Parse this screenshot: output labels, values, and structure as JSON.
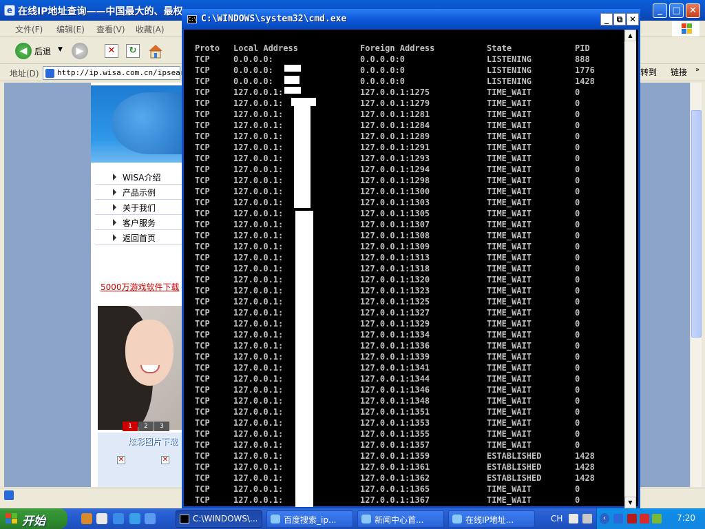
{
  "ie": {
    "title": "在线IP地址查询——中国最大的、最权",
    "menu": [
      "文件(F)",
      "编辑(E)",
      "查看(V)",
      "收藏(A)"
    ],
    "back_label": "后退",
    "address_label": "地址(D)",
    "url": "http://ip.wisa.com.cn/ipsearch",
    "go_label": "转到",
    "links_label": "链接"
  },
  "site": {
    "nav": [
      "WISA介绍",
      "产品示例",
      "关于我们",
      "客户服务",
      "返回首页"
    ],
    "ad_text": "5000万游戏软件下载",
    "pager": [
      "1",
      "2",
      "3"
    ],
    "download_title": "炫彩图片下载"
  },
  "cmd": {
    "title": "C:\\WINDOWS\\system32\\cmd.exe",
    "header": {
      "proto": "Proto",
      "local": "Local Address",
      "foreign": "Foreign Address",
      "state": "State",
      "pid": "PID"
    },
    "rows": [
      {
        "proto": "TCP",
        "local": "0.0.0.0:",
        "foreign": "0.0.0.0:0",
        "state": "LISTENING",
        "pid": "888"
      },
      {
        "proto": "TCP",
        "local": "0.0.0.0:",
        "foreign": "0.0.0.0:0",
        "state": "LISTENING",
        "pid": "1776"
      },
      {
        "proto": "TCP",
        "local": "0.0.0.0:",
        "foreign": "0.0.0.0:0",
        "state": "LISTENING",
        "pid": "1428"
      },
      {
        "proto": "TCP",
        "local": "127.0.0.1:",
        "foreign": "127.0.0.1:1275",
        "state": "TIME_WAIT",
        "pid": "0"
      },
      {
        "proto": "TCP",
        "local": "127.0.0.1:",
        "foreign": "127.0.0.1:1279",
        "state": "TIME_WAIT",
        "pid": "0"
      },
      {
        "proto": "TCP",
        "local": "127.0.0.1:",
        "foreign": "127.0.0.1:1281",
        "state": "TIME_WAIT",
        "pid": "0"
      },
      {
        "proto": "TCP",
        "local": "127.0.0.1:",
        "foreign": "127.0.0.1:1284",
        "state": "TIME_WAIT",
        "pid": "0"
      },
      {
        "proto": "TCP",
        "local": "127.0.0.1:",
        "foreign": "127.0.0.1:1289",
        "state": "TIME_WAIT",
        "pid": "0"
      },
      {
        "proto": "TCP",
        "local": "127.0.0.1:",
        "foreign": "127.0.0.1:1291",
        "state": "TIME_WAIT",
        "pid": "0"
      },
      {
        "proto": "TCP",
        "local": "127.0.0.1:",
        "foreign": "127.0.0.1:1293",
        "state": "TIME_WAIT",
        "pid": "0"
      },
      {
        "proto": "TCP",
        "local": "127.0.0.1:",
        "foreign": "127.0.0.1:1294",
        "state": "TIME_WAIT",
        "pid": "0"
      },
      {
        "proto": "TCP",
        "local": "127.0.0.1:",
        "foreign": "127.0.0.1:1298",
        "state": "TIME_WAIT",
        "pid": "0"
      },
      {
        "proto": "TCP",
        "local": "127.0.0.1:",
        "foreign": "127.0.0.1:1300",
        "state": "TIME_WAIT",
        "pid": "0"
      },
      {
        "proto": "TCP",
        "local": "127.0.0.1:",
        "foreign": "127.0.0.1:1303",
        "state": "TIME_WAIT",
        "pid": "0"
      },
      {
        "proto": "TCP",
        "local": "127.0.0.1:",
        "foreign": "127.0.0.1:1305",
        "state": "TIME_WAIT",
        "pid": "0"
      },
      {
        "proto": "TCP",
        "local": "127.0.0.1:",
        "foreign": "127.0.0.1:1307",
        "state": "TIME_WAIT",
        "pid": "0"
      },
      {
        "proto": "TCP",
        "local": "127.0.0.1:",
        "foreign": "127.0.0.1:1308",
        "state": "TIME_WAIT",
        "pid": "0"
      },
      {
        "proto": "TCP",
        "local": "127.0.0.1:",
        "foreign": "127.0.0.1:1309",
        "state": "TIME_WAIT",
        "pid": "0"
      },
      {
        "proto": "TCP",
        "local": "127.0.0.1:",
        "foreign": "127.0.0.1:1313",
        "state": "TIME_WAIT",
        "pid": "0"
      },
      {
        "proto": "TCP",
        "local": "127.0.0.1:",
        "foreign": "127.0.0.1:1318",
        "state": "TIME_WAIT",
        "pid": "0"
      },
      {
        "proto": "TCP",
        "local": "127.0.0.1:",
        "foreign": "127.0.0.1:1320",
        "state": "TIME_WAIT",
        "pid": "0"
      },
      {
        "proto": "TCP",
        "local": "127.0.0.1:",
        "foreign": "127.0.0.1:1323",
        "state": "TIME_WAIT",
        "pid": "0"
      },
      {
        "proto": "TCP",
        "local": "127.0.0.1:",
        "foreign": "127.0.0.1:1325",
        "state": "TIME_WAIT",
        "pid": "0"
      },
      {
        "proto": "TCP",
        "local": "127.0.0.1:",
        "foreign": "127.0.0.1:1327",
        "state": "TIME_WAIT",
        "pid": "0"
      },
      {
        "proto": "TCP",
        "local": "127.0.0.1:",
        "foreign": "127.0.0.1:1329",
        "state": "TIME_WAIT",
        "pid": "0"
      },
      {
        "proto": "TCP",
        "local": "127.0.0.1:",
        "foreign": "127.0.0.1:1334",
        "state": "TIME_WAIT",
        "pid": "0"
      },
      {
        "proto": "TCP",
        "local": "127.0.0.1:",
        "foreign": "127.0.0.1:1336",
        "state": "TIME_WAIT",
        "pid": "0"
      },
      {
        "proto": "TCP",
        "local": "127.0.0.1:",
        "foreign": "127.0.0.1:1339",
        "state": "TIME_WAIT",
        "pid": "0"
      },
      {
        "proto": "TCP",
        "local": "127.0.0.1:",
        "foreign": "127.0.0.1:1341",
        "state": "TIME_WAIT",
        "pid": "0"
      },
      {
        "proto": "TCP",
        "local": "127.0.0.1:",
        "foreign": "127.0.0.1:1344",
        "state": "TIME_WAIT",
        "pid": "0"
      },
      {
        "proto": "TCP",
        "local": "127.0.0.1:",
        "foreign": "127.0.0.1:1346",
        "state": "TIME_WAIT",
        "pid": "0"
      },
      {
        "proto": "TCP",
        "local": "127.0.0.1:",
        "foreign": "127.0.0.1:1348",
        "state": "TIME_WAIT",
        "pid": "0"
      },
      {
        "proto": "TCP",
        "local": "127.0.0.1:",
        "foreign": "127.0.0.1:1351",
        "state": "TIME_WAIT",
        "pid": "0"
      },
      {
        "proto": "TCP",
        "local": "127.0.0.1:",
        "foreign": "127.0.0.1:1353",
        "state": "TIME_WAIT",
        "pid": "0"
      },
      {
        "proto": "TCP",
        "local": "127.0.0.1:",
        "foreign": "127.0.0.1:1355",
        "state": "TIME_WAIT",
        "pid": "0"
      },
      {
        "proto": "TCP",
        "local": "127.0.0.1:",
        "foreign": "127.0.0.1:1357",
        "state": "TIME_WAIT",
        "pid": "0"
      },
      {
        "proto": "TCP",
        "local": "127.0.0.1:",
        "foreign": "127.0.0.1:1359",
        "state": "ESTABLISHED",
        "pid": "1428"
      },
      {
        "proto": "TCP",
        "local": "127.0.0.1:",
        "foreign": "127.0.0.1:1361",
        "state": "ESTABLISHED",
        "pid": "1428"
      },
      {
        "proto": "TCP",
        "local": "127.0.0.1:",
        "foreign": "127.0.0.1:1362",
        "state": "ESTABLISHED",
        "pid": "1428"
      },
      {
        "proto": "TCP",
        "local": "127.0.0.1:",
        "foreign": "127.0.0.1:1365",
        "state": "TIME_WAIT",
        "pid": "0"
      },
      {
        "proto": "TCP",
        "local": "127.0.0.1:",
        "foreign": "127.0.0.1:1367",
        "state": "TIME_WAIT",
        "pid": "0"
      }
    ]
  },
  "taskbar": {
    "start_label": "开始",
    "tasks": [
      "C:\\WINDOWS\\...",
      "百度搜索_ip...",
      "新闻中心首...",
      "在线IP地址..."
    ],
    "language": "CH",
    "clock": "7:20"
  }
}
